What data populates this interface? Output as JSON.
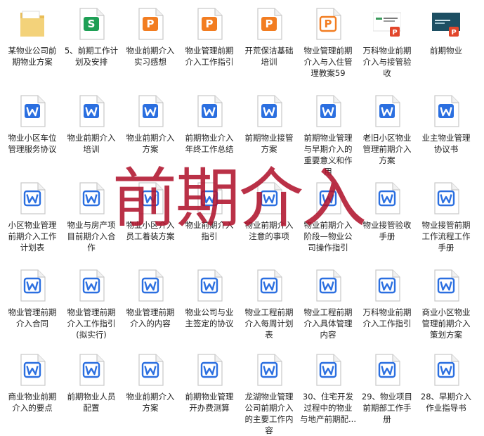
{
  "colors": {
    "word_blue": "#2b6fe0",
    "ppt_orange": "#f27d21",
    "wps_green": "#1e9f55",
    "pdf_red": "#e2462b",
    "folder_yellow": "#f3d27a",
    "overlay_red": "#b0142d"
  },
  "overlay_text": "前期介入",
  "files": [
    {
      "label": "某物业公司前期物业方案",
      "icon": "folder-icon"
    },
    {
      "label": "5、前期工作计划及安排",
      "icon": "wps-sheet-icon"
    },
    {
      "label": "物业前期介入实习感想",
      "icon": "ppt-icon"
    },
    {
      "label": "物业管理前期介入工作指引",
      "icon": "ppt-icon"
    },
    {
      "label": "开荒保洁基础培训",
      "icon": "ppt-icon"
    },
    {
      "label": "物业管理前期介入与入住管理教案59",
      "icon": "ppt-outline-icon"
    },
    {
      "label": "万科物业前期介入与接管验收",
      "icon": "ppt-thumb-light-icon"
    },
    {
      "label": "前期物业",
      "icon": "ppt-thumb-dark-icon"
    },
    {
      "label": "物业小区车位管理服务协议",
      "icon": "word-icon"
    },
    {
      "label": "物业前期介入培训",
      "icon": "word-icon"
    },
    {
      "label": "物业前期介入方案",
      "icon": "word-icon"
    },
    {
      "label": "前期物业介入年终工作总结",
      "icon": "word-icon"
    },
    {
      "label": "前期物业接管方案",
      "icon": "word-icon"
    },
    {
      "label": "前期物业管理与早期介入的重要意义和作用",
      "icon": "word-icon"
    },
    {
      "label": "老旧小区物业管理前期介入方案",
      "icon": "word-icon"
    },
    {
      "label": "业主物业管理协议书",
      "icon": "word-icon"
    },
    {
      "label": "小区物业管理前期介入工作计划表",
      "icon": "word-outline-icon"
    },
    {
      "label": "物业与房产项目前期介入合作",
      "icon": "word-outline-icon"
    },
    {
      "label": "物业小区介入员工着装方案",
      "icon": "word-outline-icon"
    },
    {
      "label": "物业前期介入指引",
      "icon": "word-outline-icon"
    },
    {
      "label": "物业前期介入注意的事项",
      "icon": "word-outline-icon"
    },
    {
      "label": "物业前期介入阶段—物业公司操作指引",
      "icon": "word-outline-icon"
    },
    {
      "label": "物业接管验收手册",
      "icon": "word-outline-icon"
    },
    {
      "label": "物业接管前期工作流程工作手册",
      "icon": "word-outline-icon"
    },
    {
      "label": "物业管理前期介入合同",
      "icon": "word-outline-icon"
    },
    {
      "label": "物业管理前期介入工作指引(拟实行)",
      "icon": "word-outline-icon"
    },
    {
      "label": "物业管理前期介入的内容",
      "icon": "word-outline-icon"
    },
    {
      "label": "物业公司与业主签定的协议",
      "icon": "word-outline-icon"
    },
    {
      "label": "物业工程前期介入每周计划表",
      "icon": "word-outline-icon"
    },
    {
      "label": "物业工程前期介入具体管理内容",
      "icon": "word-outline-icon"
    },
    {
      "label": "万科物业前期介入工作指引",
      "icon": "word-outline-icon"
    },
    {
      "label": "商业小区物业管理前期介入策划方案",
      "icon": "word-outline-icon"
    },
    {
      "label": "商业物业前期介入的要点",
      "icon": "word-outline-icon"
    },
    {
      "label": "前期物业人员配置",
      "icon": "word-outline-icon"
    },
    {
      "label": "物业前期介入方案",
      "icon": "word-outline-icon"
    },
    {
      "label": "前期物业管理开办费测算",
      "icon": "word-outline-icon"
    },
    {
      "label": "龙湖物业管理公司前期介入的主要工作内容",
      "icon": "word-outline-icon"
    },
    {
      "label": "30、住宅开发过程中的物业与地产前期配...",
      "icon": "word-outline-icon"
    },
    {
      "label": "29、物业项目前期部工作手册",
      "icon": "word-outline-icon"
    },
    {
      "label": "28、早期介入作业指导书",
      "icon": "word-outline-icon"
    }
  ]
}
